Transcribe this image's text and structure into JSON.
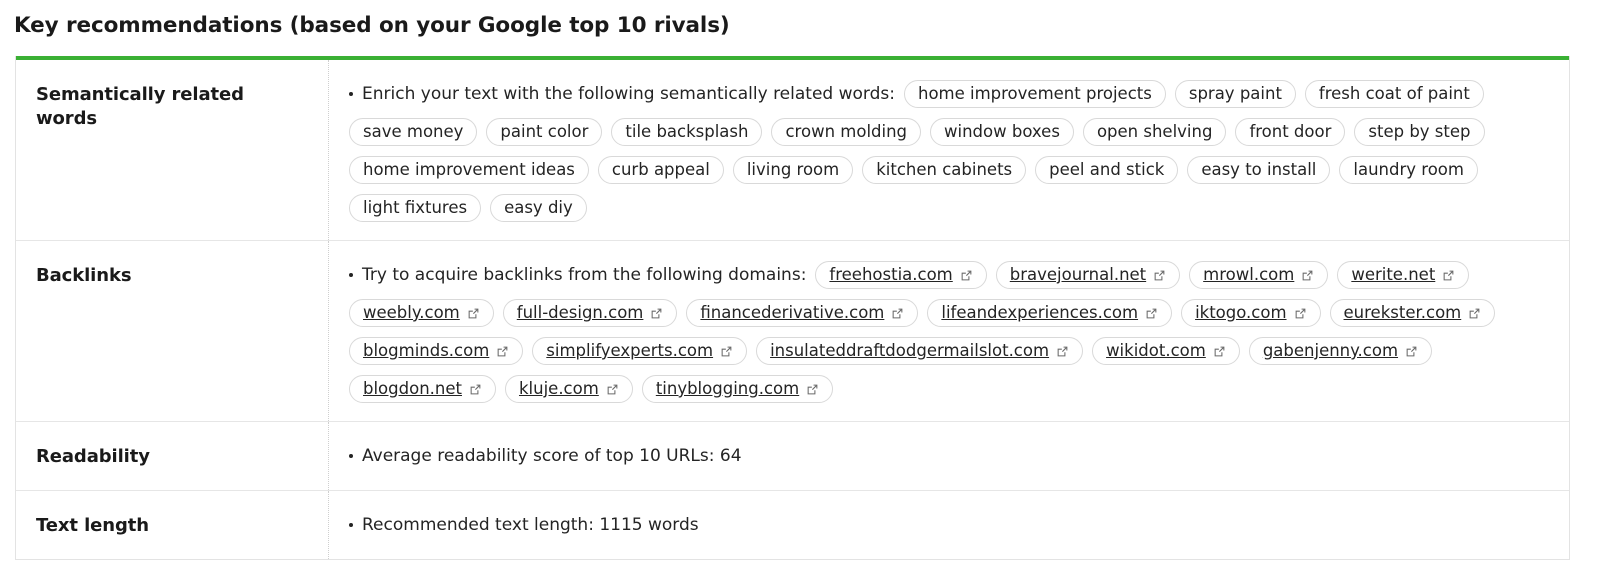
{
  "header": {
    "title": "Key recommendations (based on your Google top 10 rivals)"
  },
  "theme": {
    "accent_color": "#3ab034",
    "border_color": "#e3e3e3",
    "pill_border_color": "#d9d9d9",
    "text_color": "#242424"
  },
  "rows": [
    {
      "label": "Semantically related words",
      "intro": "Enrich your text with the following semantically related words:",
      "type": "tags",
      "tags": [
        "home improvement projects",
        "spray paint",
        "fresh coat of paint",
        "save money",
        "paint color",
        "tile backsplash",
        "crown molding",
        "window boxes",
        "open shelving",
        "front door",
        "step by step",
        "home improvement ideas",
        "curb appeal",
        "living room",
        "kitchen cabinets",
        "peel and stick",
        "easy to install",
        "laundry room",
        "light fixtures",
        "easy diy"
      ]
    },
    {
      "label": "Backlinks",
      "intro": "Try to acquire backlinks from the following domains:",
      "type": "links",
      "icon": "external-link-icon",
      "tags": [
        "freehostia.com",
        "bravejournal.net",
        "mrowl.com",
        "werite.net",
        "weebly.com",
        "full-design.com",
        "financederivative.com",
        "lifeandexperiences.com",
        "iktogo.com",
        "eurekster.com",
        "blogminds.com",
        "simplifyexperts.com",
        "insulateddraftdodgermailslot.com",
        "wikidot.com",
        "gabenjenny.com",
        "blogdon.net",
        "kluje.com",
        "tinyblogging.com"
      ]
    },
    {
      "label": "Readability",
      "type": "text",
      "text": "Average readability score of top 10 URLs:  64"
    },
    {
      "label": "Text length",
      "type": "text",
      "text": "Recommended text length: 1115 words"
    }
  ]
}
